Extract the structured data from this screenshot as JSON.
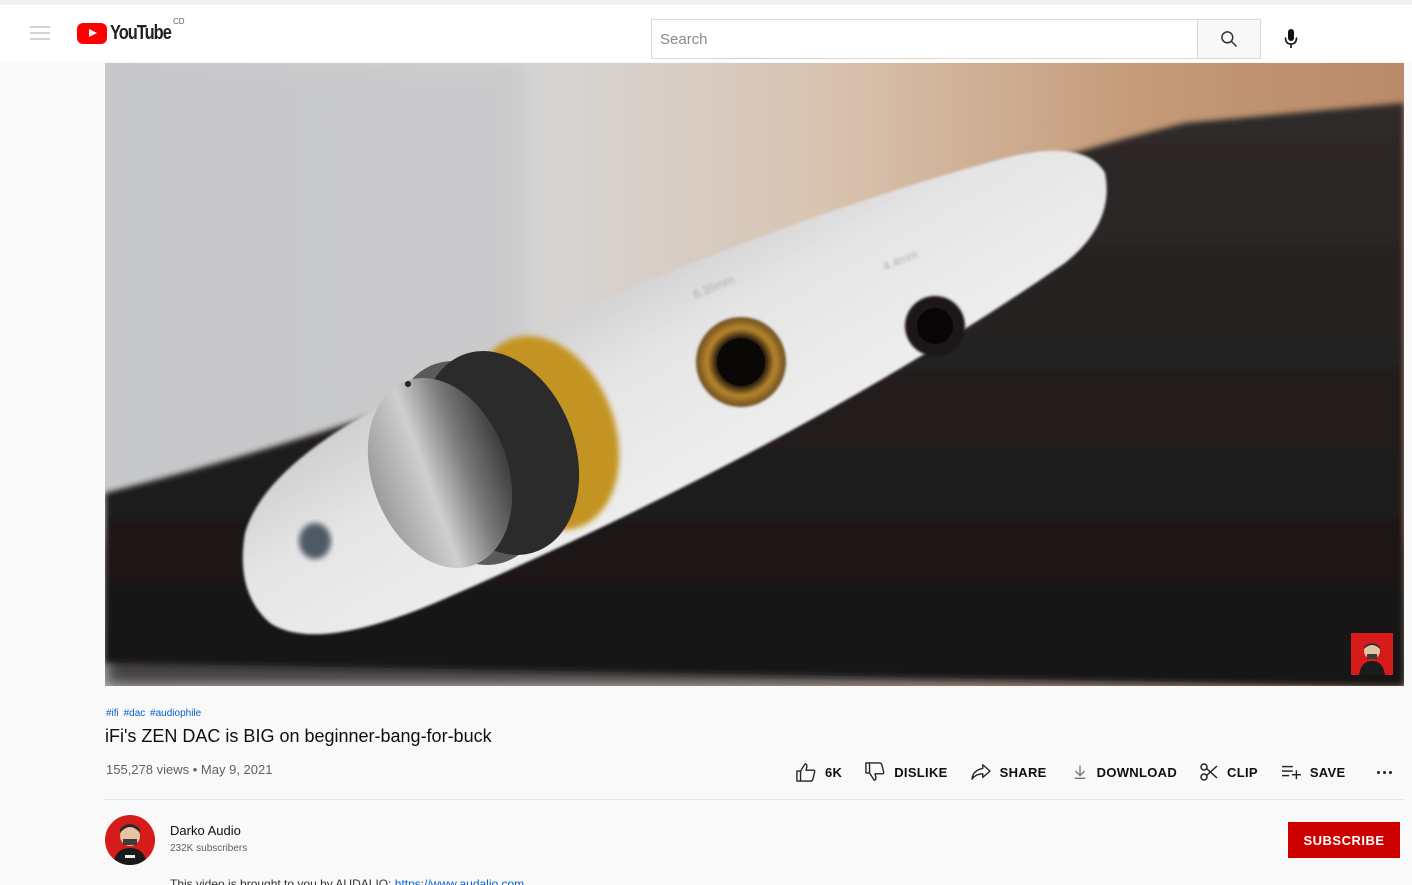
{
  "header": {
    "logo_text": "YouTube",
    "logo_country": "CD",
    "search_placeholder": "Search"
  },
  "video": {
    "hashtags": [
      "#ifi",
      "#dac",
      "#audiophile"
    ],
    "title": "iFi's ZEN DAC is BIG on beginner-bang-for-buck",
    "views": "155,278 views",
    "date": "May 9, 2021"
  },
  "actions": {
    "like_count": "6K",
    "dislike_label": "DISLIKE",
    "share_label": "SHARE",
    "download_label": "DOWNLOAD",
    "clip_label": "CLIP",
    "save_label": "SAVE"
  },
  "channel": {
    "name": "Darko Audio",
    "subscribers": "232K subscribers",
    "subscribe_label": "SUBSCRIBE"
  },
  "description": {
    "text": "This video is brought to you by AUDALIO: ",
    "link": "https://www.audalio.com"
  },
  "colors": {
    "brand_red": "#ff0000",
    "subscribe_red": "#cc0000",
    "link_blue": "#065fd4"
  },
  "icons": [
    "menu-icon",
    "youtube-logo-icon",
    "search-icon",
    "mic-icon",
    "like-icon",
    "dislike-icon",
    "share-icon",
    "download-icon",
    "clip-icon",
    "save-playlist-icon",
    "more-icon"
  ]
}
